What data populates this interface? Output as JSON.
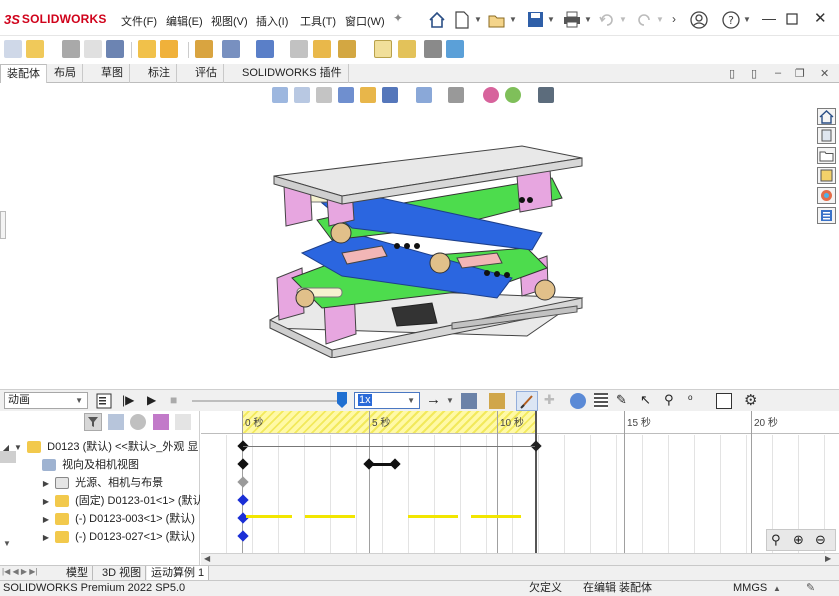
{
  "app": {
    "logo_ds": "3S",
    "logo_text": "SOLIDWORKS"
  },
  "menu": [
    {
      "label": "文件(F)"
    },
    {
      "label": "编辑(E)"
    },
    {
      "label": "视图(V)"
    },
    {
      "label": "插入(I)"
    },
    {
      "label": "工具(T)"
    },
    {
      "label": "窗口(W)"
    }
  ],
  "tabs": [
    {
      "label": "装配体",
      "active": true
    },
    {
      "label": "布局"
    },
    {
      "label": "草图"
    },
    {
      "label": "标注"
    },
    {
      "label": "评估"
    },
    {
      "label": "SOLIDWORKS 插件"
    }
  ],
  "motion": {
    "study_type": "动画",
    "speed": "1x"
  },
  "timeline": {
    "ticks": [
      "0 秒",
      "5 秒",
      "10 秒",
      "15 秒",
      "20 秒"
    ]
  },
  "tree": [
    {
      "label": "D0123 (默认) <<默认>_外观 显"
    },
    {
      "label": "视向及相机视图"
    },
    {
      "label": "光源、相机与布景"
    },
    {
      "label": "(固定) D0123-01<1> (默认"
    },
    {
      "label": "(-) D0123-003<1> (默认)"
    },
    {
      "label": "(-) D0123-027<1> (默认)"
    }
  ],
  "bottom_tabs": [
    {
      "label": "模型"
    },
    {
      "label": "3D 视图"
    },
    {
      "label": "运动算例 1",
      "active": true
    }
  ],
  "status": {
    "product": "SOLIDWORKS Premium 2022 SP5.0",
    "state1": "欠定义",
    "state2": "在编辑 装配体",
    "units": "MMGS"
  },
  "colors": {
    "plate": "#d8d8d8",
    "pink": "#e7a6e0",
    "green": "#4ddc4d",
    "blue": "#2b66e0",
    "accent_red": "#d0021b",
    "yellow": "#f2e600"
  }
}
